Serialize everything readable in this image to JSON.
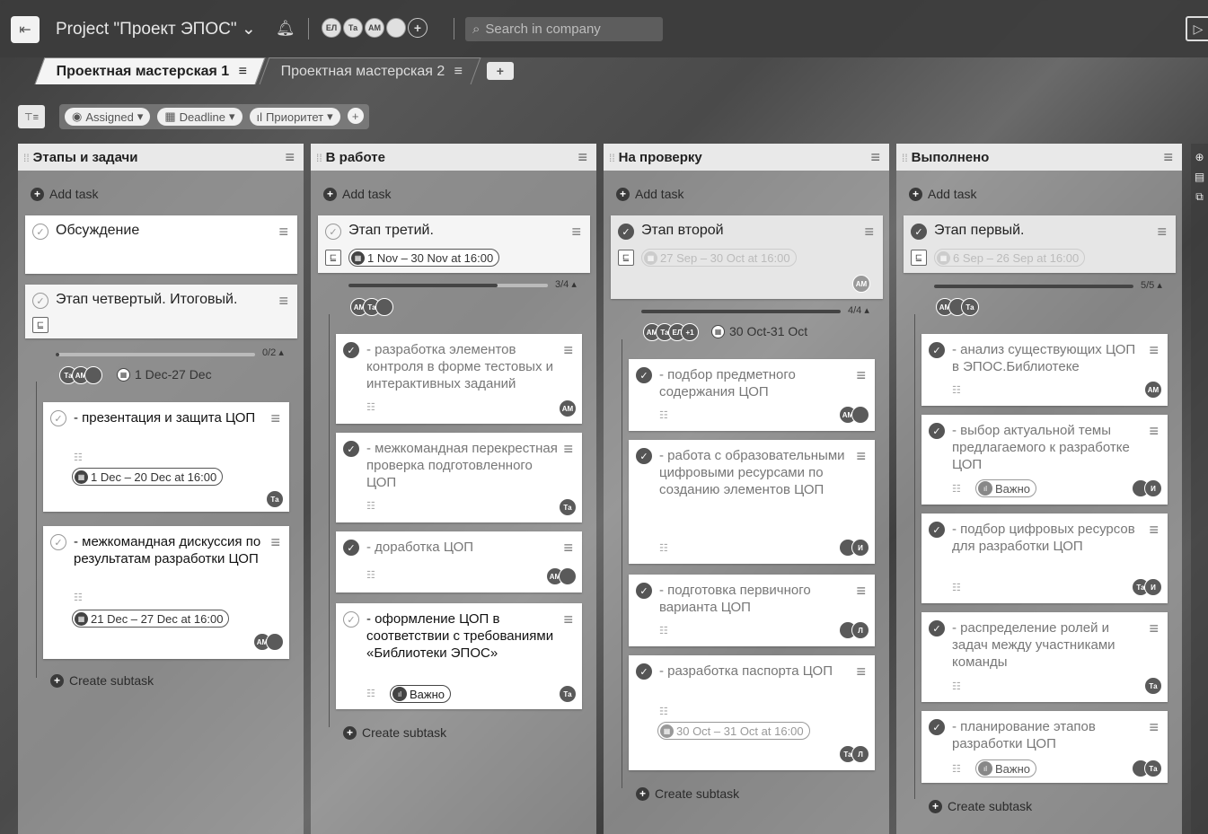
{
  "header": {
    "menu_icon": "sidebar-toggle-icon",
    "project_title": "Project \"Проект ЭПОС\"",
    "members": [
      "ЕЛ",
      "Та",
      "АМ",
      "",
      "+"
    ],
    "search_placeholder": "Search in company"
  },
  "tabs": [
    {
      "label": "Проектная мастерская 1",
      "active": true
    },
    {
      "label": "Проектная мастерская 2",
      "active": false
    }
  ],
  "filters": {
    "assigned": "Assigned",
    "deadline": "Deadline",
    "priority": "Приоритет"
  },
  "common": {
    "add_task": "Add task",
    "create_subtask": "Create subtask"
  },
  "columns": [
    {
      "title": "Этапы и задачи",
      "cards": {
        "c1": {
          "title": "Обсуждение"
        },
        "c2": {
          "title": "Этап четвертый. Итоговый.",
          "progress_label": "0/2",
          "progress": 0.0,
          "assignees": [
            "Та",
            "АМ",
            ""
          ],
          "range": "1 Dec-27 Dec",
          "subtasks": [
            {
              "title": "- презентация и защита ЦОП",
              "date": "1 Dec – 20 Dec at 16:00",
              "assignees": [
                "Та"
              ]
            },
            {
              "title": "- межкомандная дискуссия по результатам разработки ЦОП",
              "date": "21 Dec – 27 Dec at 16:00",
              "assignees": [
                "АМ",
                ""
              ]
            }
          ]
        }
      }
    },
    {
      "title": "В работе",
      "cards": {
        "c1": {
          "title": "Этап третий.",
          "date": "1 Nov – 30 Nov at 16:00",
          "progress_label": "3/4",
          "progress": 0.75,
          "assignees": [
            "АМ",
            "Та",
            ""
          ],
          "subtasks": [
            {
              "title": "- разработка элементов контроля в форме тестовых и интерактивных заданий",
              "assignees": [
                "АМ"
              ]
            },
            {
              "title": "- межкомандная перекрестная проверка подготовленного ЦОП",
              "assignees": [
                "Та"
              ]
            },
            {
              "title": "- доработка ЦОП",
              "assignees": [
                "АМ",
                ""
              ]
            },
            {
              "title": "- оформление ЦОП в соответствии с требованиями «Библиотеки ЭПОС»",
              "priority": "Важно",
              "assignees": [
                "Та"
              ]
            }
          ]
        }
      }
    },
    {
      "title": "На проверку",
      "cards": {
        "c1": {
          "title": "Этап второй",
          "date": "27 Sep – 30 Oct at 16:00",
          "assignees": [
            "АМ"
          ],
          "progress_label": "4/4",
          "progress": 1.0,
          "range_assignees": [
            "АМ",
            "Та",
            "ЕЛ",
            "+1"
          ],
          "range": "30 Oct-31 Oct",
          "subtasks": [
            {
              "title": "- подбор предметного содержания ЦОП",
              "assignees": [
                "АМ",
                ""
              ]
            },
            {
              "title": "- работа с образовательными цифровыми ресурсами по созданию элементов ЦОП",
              "assignees": [
                "",
                "И"
              ]
            },
            {
              "title": "- подготовка первичного варианта ЦОП",
              "assignees": [
                "",
                "Л"
              ]
            },
            {
              "title": "- разработка паспорта ЦОП",
              "date": "30 Oct – 31 Oct at 16:00",
              "assignees": [
                "Та",
                "Л"
              ]
            }
          ]
        }
      }
    },
    {
      "title": "Выполнено",
      "cards": {
        "c1": {
          "title": "Этап первый.",
          "date": "6 Sep – 26 Sep at 16:00",
          "progress_label": "5/5",
          "progress": 1.0,
          "assignees": [
            "АМ",
            "",
            "Та"
          ],
          "subtasks": [
            {
              "title": "- анализ существующих ЦОП в ЭПОС.Библиотеке",
              "assignees": [
                "АМ"
              ]
            },
            {
              "title": "- выбор актуальной темы предлагаемого к разработке ЦОП",
              "priority": "Важно",
              "assignees": [
                "",
                "И"
              ]
            },
            {
              "title": "- подбор цифровых ресурсов для разработки ЦОП",
              "assignees": [
                "Та",
                "И"
              ]
            },
            {
              "title": "- распределение ролей и задач между участниками команды",
              "assignees": [
                "Та"
              ]
            },
            {
              "title": "- планирование этапов разработки ЦОП",
              "priority": "Важно",
              "assignees": [
                "",
                "Та"
              ]
            }
          ]
        }
      }
    }
  ],
  "colors": {
    "bar_bg": "#3c3c3c",
    "card_bg": "#ffffff",
    "column_bg": "#bebebe"
  }
}
